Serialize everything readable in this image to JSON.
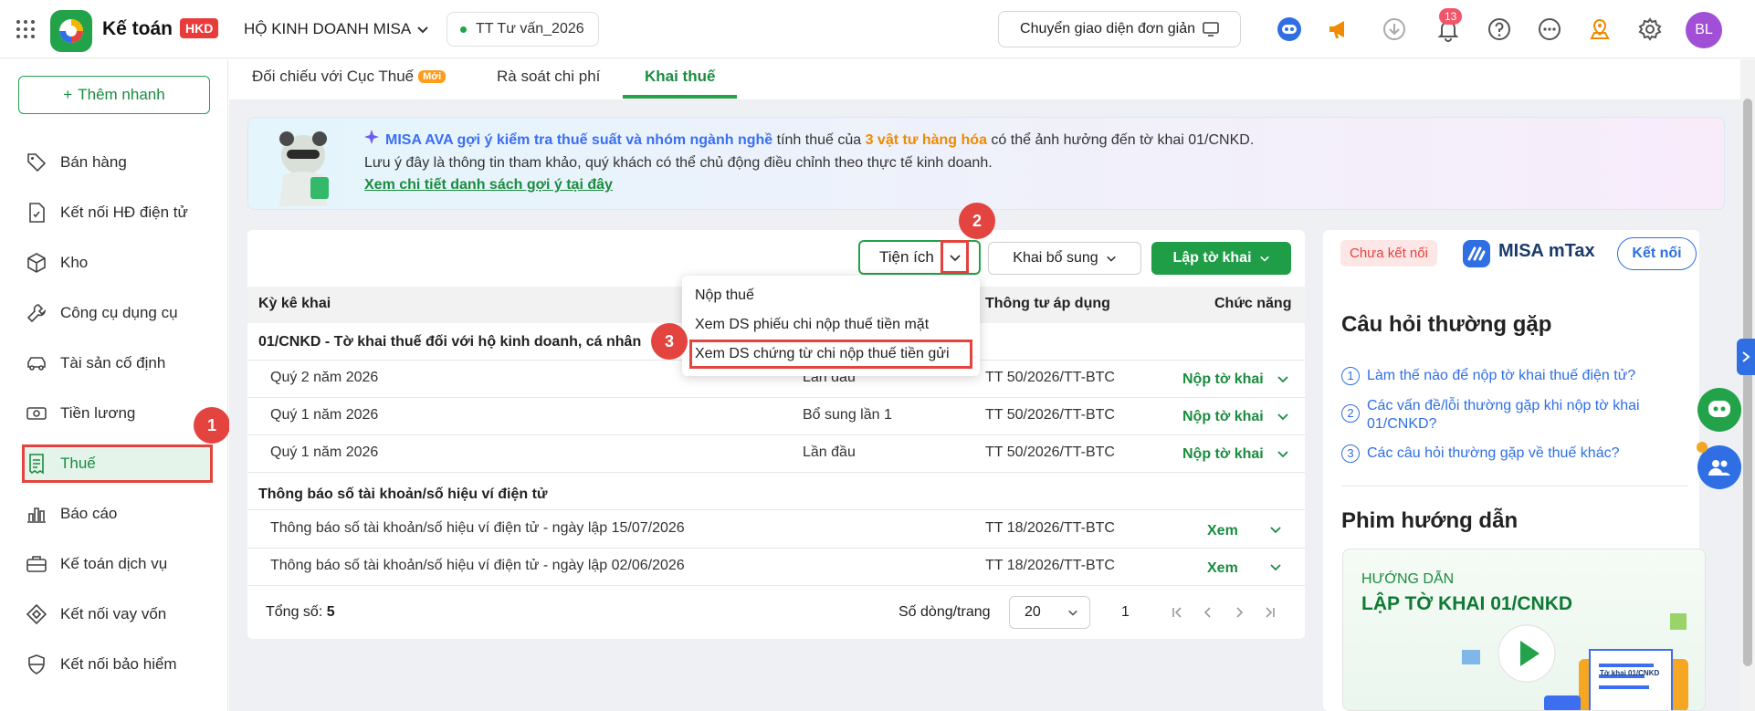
{
  "header": {
    "app_name": "Kế toán",
    "app_badge": "HKD",
    "business": "HỘ KINH DOANH MISA",
    "workspace": "TT Tư vấn_2026",
    "simple_ui": "Chuyển giao diện đơn giản",
    "notification_count": "13",
    "avatar": "BL"
  },
  "sidebar": {
    "quick_add": "Thêm nhanh",
    "items": [
      {
        "label": "Bán hàng",
        "icon": "tag-icon"
      },
      {
        "label": "Kết nối HĐ điện tử",
        "icon": "invoice-icon"
      },
      {
        "label": "Kho",
        "icon": "box-icon"
      },
      {
        "label": "Công cụ dụng cụ",
        "icon": "tools-icon"
      },
      {
        "label": "Tài sản cố định",
        "icon": "car-icon"
      },
      {
        "label": "Tiền lương",
        "icon": "money-icon"
      },
      {
        "label": "Thuế",
        "icon": "receipt-icon"
      },
      {
        "label": "Báo cáo",
        "icon": "chart-icon"
      },
      {
        "label": "Kế toán dịch vụ",
        "icon": "briefcase-icon"
      },
      {
        "label": "Kết nối vay vốn",
        "icon": "loan-icon"
      },
      {
        "label": "Kết nối bảo hiểm",
        "icon": "shield-icon"
      }
    ]
  },
  "tabs": [
    {
      "label": "Đối chiếu với Cục Thuế",
      "badge": "Mới"
    },
    {
      "label": "Rà soát chi phí"
    },
    {
      "label": "Khai thuế"
    }
  ],
  "banner": {
    "ava": "MISA AVA gợi ý kiểm tra thuế suất và nhóm ngành nghề",
    "line1_mid": " tính thuế của ",
    "count_items": "3 vật tư hàng hóa",
    "line1_end": " có thể ảnh hưởng đến tờ khai 01/CNKD.",
    "line2": "Lưu ý đây là thông tin tham khảo, quý khách có thể chủ động điều chỉnh theo thực tế kinh doanh.",
    "link": "Xem chi tiết danh sách gợi ý tại đây"
  },
  "toolbar": {
    "utilities": "Tiện ích",
    "supplement": "Khai bổ sung",
    "create": "Lập tờ khai"
  },
  "dropdown": {
    "items": [
      "Nộp thuế",
      "Xem DS phiếu chi nộp thuế tiền mặt",
      "Xem DS chứng từ chi nộp thuế tiền gửi"
    ]
  },
  "table": {
    "headers": {
      "period": "Kỳ kê khai",
      "circular": "Thông tư áp dụng",
      "action": "Chức năng"
    },
    "group1": "01/CNKD - Tờ khai thuế đối với hộ kinh doanh, cá nhân",
    "rows1": [
      {
        "period": "Quý 2 năm 2026",
        "type": "Lần đầu",
        "circular": "TT 50/2026/TT-BTC",
        "action": "Nộp tờ khai"
      },
      {
        "period": "Quý 1 năm 2026",
        "type": "Bổ sung lần 1",
        "circular": "TT 50/2026/TT-BTC",
        "action": "Nộp tờ khai"
      },
      {
        "period": "Quý 1 năm 2026",
        "type": "Lần đầu",
        "circular": "TT 50/2026/TT-BTC",
        "action": "Nộp tờ khai"
      }
    ],
    "group2": "Thông báo số tài khoản/số hiệu ví điện tử",
    "rows2": [
      {
        "period": "Thông báo số tài khoản/số hiệu ví điện tử - ngày lập 15/07/2026",
        "circular": "TT 18/2026/TT-BTC",
        "action": "Xem"
      },
      {
        "period": "Thông báo số tài khoản/số hiệu ví điện tử - ngày lập 02/06/2026",
        "circular": "TT 18/2026/TT-BTC",
        "action": "Xem"
      }
    ],
    "total_label": "Tổng số:",
    "total_value": "5",
    "rows_per_page_label": "Số dòng/trang",
    "rows_per_page": "20",
    "page": "1"
  },
  "right_panel": {
    "status": "Chưa kết nối",
    "brand": "MISA mTax",
    "connect": "Kết nối",
    "faq_title": "Câu hỏi thường gặp",
    "faq": [
      "Làm thế nào để nộp tờ khai thuế điện tử?",
      "Các vấn đề/lỗi thường gặp khi nộp tờ khai 01/CNKD?",
      "Các câu hỏi thường gặp về thuế khác?"
    ],
    "video_title": "Phim hướng dẫn",
    "video_small": "HƯỚNG DẪN",
    "video_big": "LẬP TỜ KHAI 01/CNKD",
    "video_doc": "Tờ khai 01/CNKD"
  },
  "steps": [
    "1",
    "2",
    "3"
  ],
  "colors": {
    "brand_green": "#22a34a",
    "highlight_red": "#e3443f",
    "link_blue": "#2f6fe3"
  }
}
